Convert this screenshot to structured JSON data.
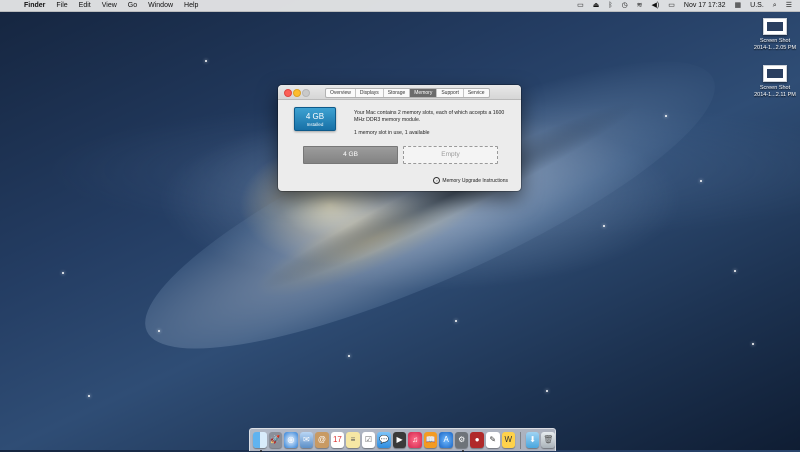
{
  "menubar": {
    "apple_icon": "apple-logo",
    "items": [
      "Finder",
      "File",
      "Edit",
      "View",
      "Go",
      "Window",
      "Help"
    ],
    "status": {
      "date_time": "Nov 17  17:32",
      "input_source": "U.S."
    }
  },
  "desktop": {
    "files": [
      {
        "name_line1": "Screen Shot",
        "name_line2": "2014-1...2.05 PM"
      },
      {
        "name_line1": "Screen Shot",
        "name_line2": "2014-1...2.11 PM"
      }
    ]
  },
  "window": {
    "tabs": [
      "Overview",
      "Displays",
      "Storage",
      "Memory",
      "Support",
      "Service"
    ],
    "active_tab": "Memory",
    "memory_badge": {
      "size": "4 GB",
      "label": "Installed"
    },
    "description": "Your Mac contains 2 memory slots, each of which accepts a 1600 MHz DDR3 memory module.",
    "slot_status": "1 memory slot in use, 1 available",
    "slots": [
      {
        "label": "4 GB",
        "state": "filled"
      },
      {
        "label": "Empty",
        "state": "empty"
      }
    ],
    "upgrade_link": "Memory Upgrade Instructions"
  },
  "dock": {
    "apps": [
      "Finder",
      "Launchpad",
      "Safari",
      "Mail",
      "Contacts",
      "Calendar",
      "Notes",
      "Reminders",
      "Messages",
      "FaceTime",
      "iTunes",
      "iBooks",
      "App Store",
      "System Preferences",
      "Photo Booth",
      "Text Editor",
      "Preview",
      "Downloads Folder",
      "Trash"
    ]
  },
  "colors": {
    "accent_blue": "#1f86c0",
    "close": "#fc5f57",
    "minimize": "#fdbc2e"
  }
}
